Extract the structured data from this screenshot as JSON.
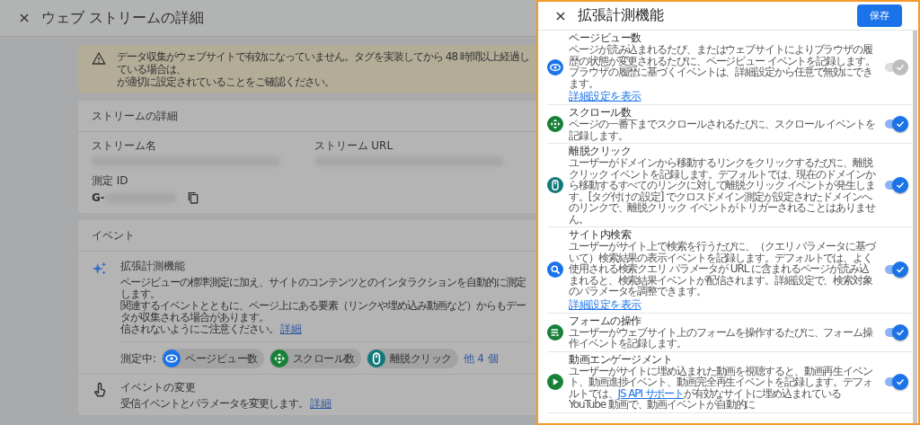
{
  "page": {
    "title": "ウェブ ストリームの詳細",
    "warning": {
      "lines": [
        "データ収集がウェブサイトで有効になっていません。タグを実装してから 48 時間以上経過している場合は、",
        "が適切に設定されていることをご確認ください。"
      ]
    },
    "stream_card": {
      "title": "ストリームの詳細",
      "fields": [
        {
          "label": "ストリーム名",
          "kind": "redacted"
        },
        {
          "label": "ストリーム URL",
          "kind": "redacted"
        }
      ],
      "measurement_id": {
        "label": "測定 ID",
        "prefix": "G-"
      }
    },
    "events_card": {
      "title": "イベント",
      "enhanced": {
        "title": "拡張計測機能",
        "lines": [
          "ページビューの標準測定に加え、サイトのコンテンツとのインタラクションを自動的に測定します。",
          "関連するイベントとともに、ページ上にある要素（リンクや埋め込み動画など）からもデータが収集される場合があります。",
          "信されないようにご注意ください。"
        ],
        "link": "詳細",
        "measuring_label": "測定中:",
        "chips": [
          {
            "label": "ページビュー数",
            "kind": "eye",
            "color": "#1a73e8"
          },
          {
            "label": "スクロール数",
            "kind": "scroll",
            "color": "#188038"
          },
          {
            "label": "離脱クリック",
            "kind": "mouse",
            "color": "#12797a"
          }
        ],
        "more_link": "他 4 個"
      },
      "modify": {
        "title": "イベントの変更",
        "description": "受信イベントとパラメータを変更します。",
        "link": "詳細"
      }
    }
  },
  "panel": {
    "title": "拡張計測機能",
    "save_button": "保存",
    "items": [
      {
        "title": "ページビュー数",
        "kind": "eye",
        "color": "#1a73e8",
        "on": true,
        "disabled": true,
        "parts": [
          {
            "kind": "text",
            "text": "ページが読み込まれるたび、またはウェブサイトによりブラウザの履歴の状態が変更されるたびに、ページビュー イベントを記録します。ブラウザの履歴に基づくイベントは、詳細設定から任意で無効にできます。"
          }
        ],
        "link": "詳細設定を表示"
      },
      {
        "title": "スクロール数",
        "kind": "scroll",
        "color": "#188038",
        "on": true,
        "disabled": false,
        "parts": [
          {
            "kind": "text",
            "text": "ページの一番下までスクロールされるたびに、スクロール イベントを記録します。"
          }
        ]
      },
      {
        "title": "離脱クリック",
        "kind": "mouse",
        "color": "#12797a",
        "on": true,
        "disabled": false,
        "parts": [
          {
            "kind": "text",
            "text": "ユーザーがドメインから移動するリンクをクリックするたびに、離脱クリック イベントを記録します。デフォルトでは、現在のドメインから移動するすべてのリンクに対して離脱クリック イベントが発生します。[タグ付けの設定] でクロスドメイン測定が設定されたドメインへのリンクで、離脱クリック イベントがトリガーされることはありません。"
          }
        ]
      },
      {
        "title": "サイト内検索",
        "kind": "search",
        "color": "#1a73e8",
        "on": true,
        "disabled": false,
        "parts": [
          {
            "kind": "text",
            "text": "ユーザーがサイト上で検索を行うたびに、（クエリ パラメータに基づいて）検索結果の表示イベントを記録します。デフォルトでは、よく使用される検索クエリ パラメータが URL に含まれるページが読み込まれると、検索結果イベントが配信されます。詳細設定で、検索対象のパラメータを調整できます。"
          }
        ],
        "link": "詳細設定を表示"
      },
      {
        "title": "フォームの操作",
        "kind": "form",
        "color": "#188038",
        "on": true,
        "disabled": false,
        "parts": [
          {
            "kind": "text",
            "text": "ユーザーがウェブサイト上のフォームを操作するたびに、フォーム操作イベントを記録します。"
          }
        ]
      },
      {
        "title": "動画エンゲージメント",
        "kind": "play",
        "color": "#188038",
        "on": true,
        "disabled": false,
        "parts": [
          {
            "kind": "text",
            "text": "ユーザーがサイトに埋め込まれた動画を視聴すると、動画再生イベント、動画進捗イベント、動画完全再生イベントを記録します。デフォルトでは、"
          },
          {
            "kind": "link",
            "text": "JS API サポート"
          },
          {
            "kind": "text",
            "text": "が有効なサイトに埋め込まれている YouTube 動画で、動画イベントが自動的に"
          }
        ]
      }
    ]
  }
}
